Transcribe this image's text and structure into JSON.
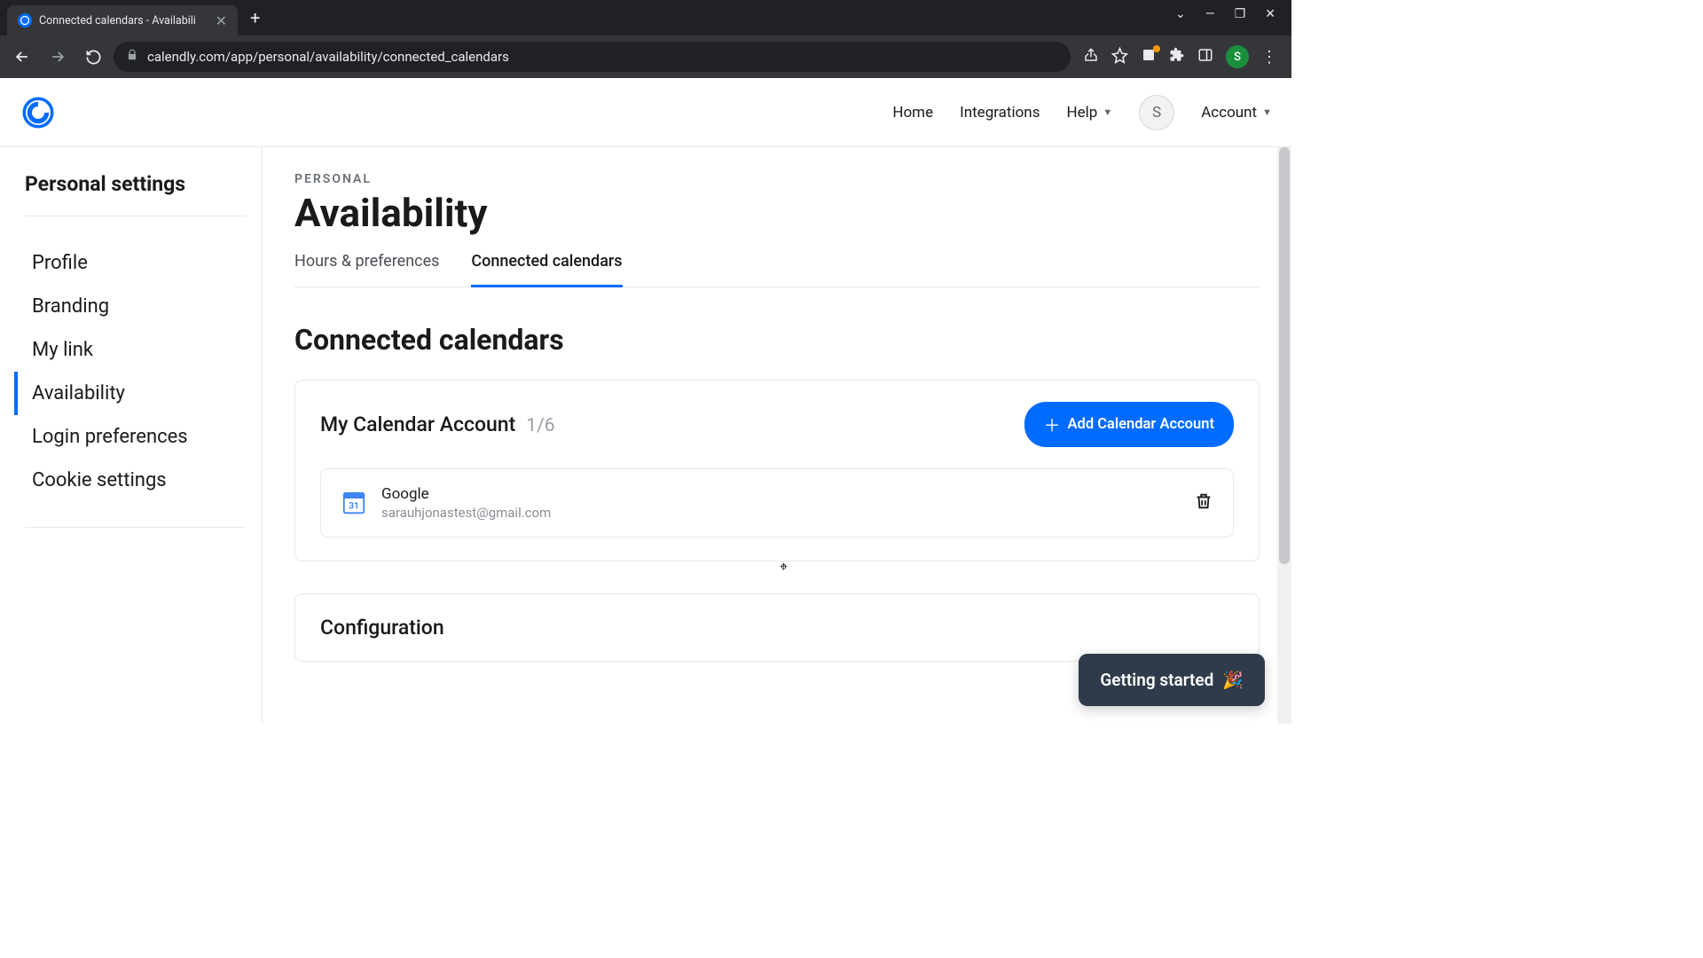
{
  "browser": {
    "tab_title": "Connected calendars - Availabili",
    "url": "calendly.com/app/personal/availability/connected_calendars",
    "profile_initial": "S"
  },
  "header": {
    "nav": {
      "home": "Home",
      "integrations": "Integrations",
      "help": "Help",
      "account": "Account"
    },
    "avatar_initial": "S"
  },
  "sidebar": {
    "title": "Personal settings",
    "items": [
      "Profile",
      "Branding",
      "My link",
      "Availability",
      "Login preferences",
      "Cookie settings"
    ],
    "active_index": 3
  },
  "main": {
    "eyebrow": "PERSONAL",
    "title": "Availability",
    "tabs": [
      "Hours & preferences",
      "Connected calendars"
    ],
    "active_tab_index": 1,
    "section_title": "Connected calendars",
    "account_card": {
      "title": "My Calendar Account",
      "count": "1/6",
      "add_button": "Add Calendar Account",
      "accounts": [
        {
          "provider": "Google",
          "email": "sarauhjonastest@gmail.com"
        }
      ]
    },
    "config_card": {
      "title": "Configuration"
    }
  },
  "getting_started": "Getting started"
}
